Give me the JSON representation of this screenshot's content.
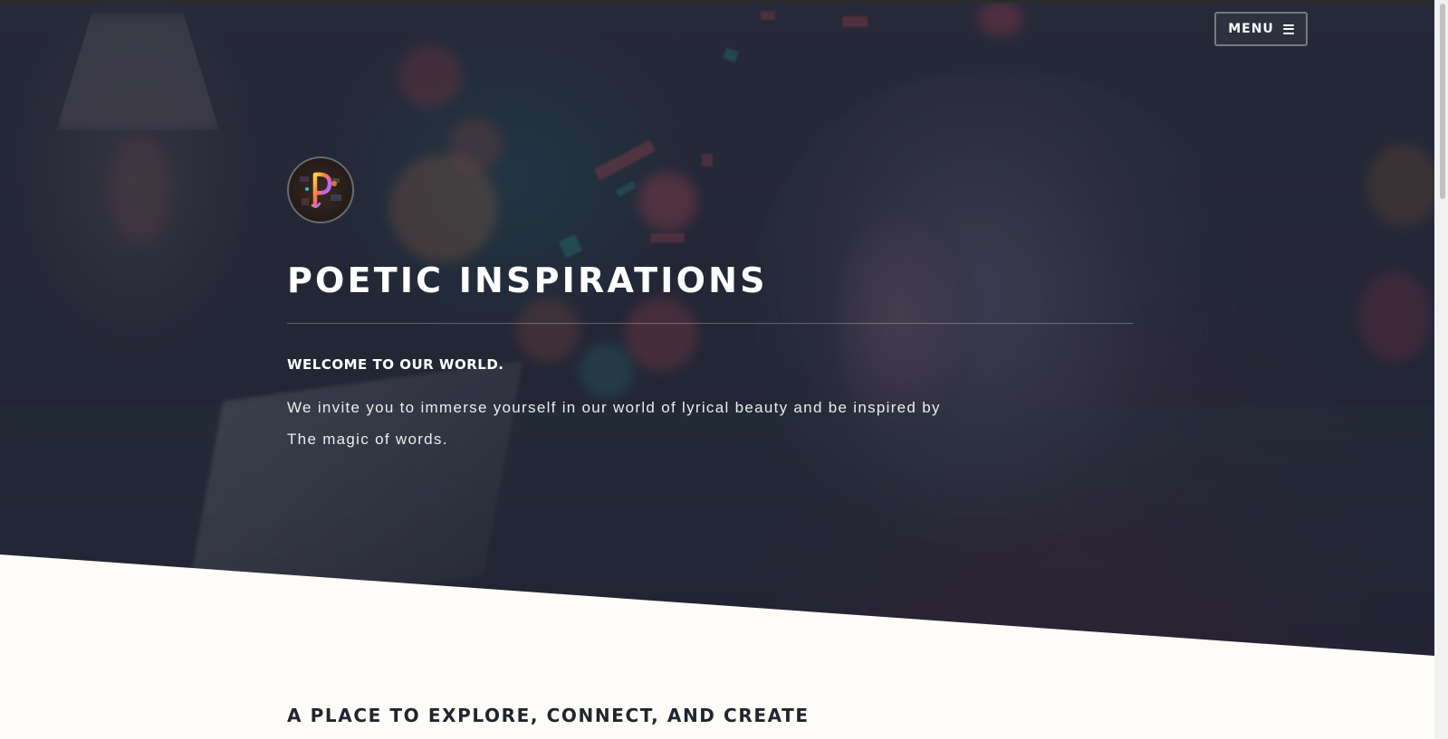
{
  "nav": {
    "menu_label": "MENU",
    "menu_icon": "hamburger-icon"
  },
  "hero": {
    "logo_icon": "poetic-p-logo",
    "title": "POETIC INSPIRATIONS",
    "welcome": "WELCOME TO OUR WORLD.",
    "intro_line1": "We invite you to immerse yourself in our world of lyrical beauty and be inspired by",
    "intro_line2": "The magic of words."
  },
  "section": {
    "heading": "A PLACE TO EXPLORE, CONNECT, AND CREATE"
  },
  "colors": {
    "hero_overlay": "#272b3a",
    "page_background": "#fdfcf8",
    "text_light": "#ffffff",
    "text_dark": "#22252e"
  }
}
